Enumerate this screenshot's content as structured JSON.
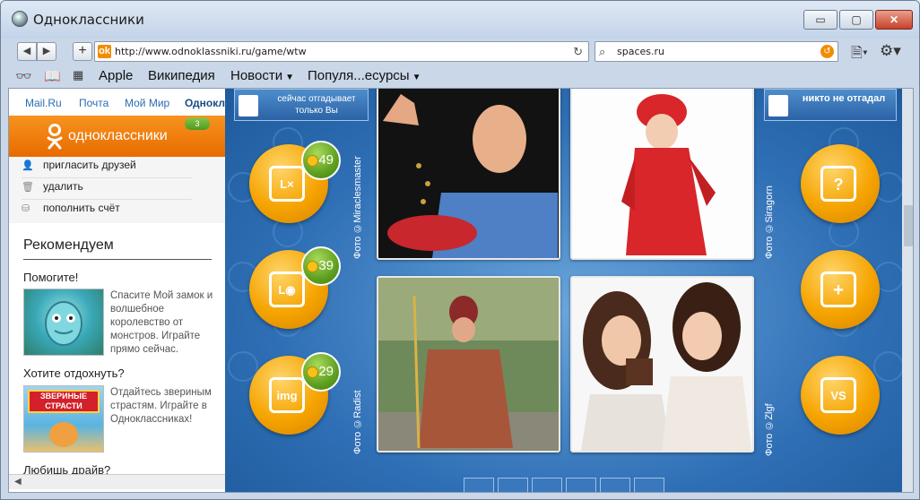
{
  "window": {
    "title": "Одноклассники",
    "min": "▭",
    "max": "▢",
    "close": "✕"
  },
  "toolbar": {
    "back": "◀",
    "forward": "▶",
    "new_tab": "+",
    "url": "http://www.odnoklassniki.ru/game/wtw",
    "favicon": "ok",
    "search_value": "spaces.ru",
    "reload": "↻",
    "search_go": "↺"
  },
  "bookmarks": {
    "items": [
      {
        "label": "Apple"
      },
      {
        "label": "Википедия"
      },
      {
        "label": "Новости",
        "dropdown": true
      },
      {
        "label": "Популя...есурсы",
        "dropdown": true
      }
    ]
  },
  "sidebar": {
    "top_links": [
      "Mail.Ru",
      "Почта",
      "Мой Мир",
      "Одноклассники"
    ],
    "ok_name": "одноклассники",
    "ok_badge": "3",
    "menu": [
      {
        "label": "пригласить друзей",
        "icon": "person-icon"
      },
      {
        "label": "удалить",
        "icon": "trash-icon"
      },
      {
        "label": "пополнить счёт",
        "icon": "coins-icon"
      }
    ],
    "recommend_title": "Рекомендуем",
    "games": [
      {
        "heading": "Помогите!",
        "desc": "Спасите Мой замок и волшебное королевство от монстров. Играйте прямо сейчас."
      },
      {
        "heading": "Хотите отдохнуть?",
        "desc": "Отдайтесь звериным страстям. Играйте в Одноклассниках!",
        "thumb_text": "ЗВЕРИНЫЕ СТРАСТИ"
      },
      {
        "heading": "Любишь драйв?"
      }
    ]
  },
  "game": {
    "left_tag": "сейчас отгадывает только Вы",
    "right_tag": "никто не отгадал",
    "left_buttons": [
      {
        "icon": "remove-photo-icon",
        "glyph": "L×",
        "count": "49"
      },
      {
        "icon": "reveal-photo-icon",
        "glyph": "L◉",
        "count": "39"
      },
      {
        "icon": "image-hint-icon",
        "glyph": "img",
        "count": "29"
      }
    ],
    "right_buttons": [
      {
        "icon": "question-person-icon",
        "glyph": "?"
      },
      {
        "icon": "add-person-icon",
        "glyph": "+"
      },
      {
        "icon": "versus-icon",
        "glyph": "VS"
      }
    ],
    "credits": [
      "Фото ©Miraclesmaster",
      "Фото ©Siragorn",
      "Фото ©Radist",
      "Фото ©Zlgf"
    ]
  }
}
